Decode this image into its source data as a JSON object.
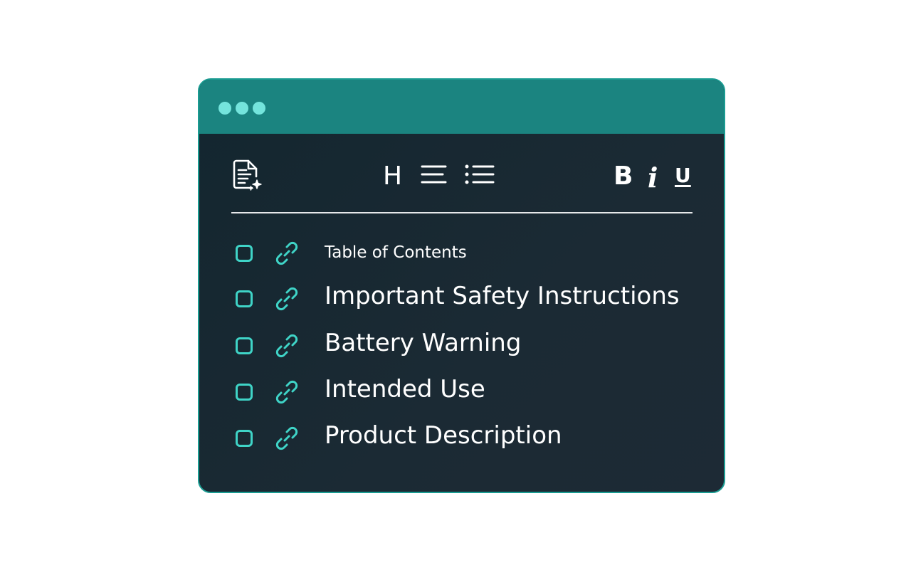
{
  "window": {
    "controls": [
      "dot",
      "dot",
      "dot"
    ]
  },
  "toolbar": {
    "doc_icon": "document-sparkle-icon",
    "heading_label": "H",
    "align_icon": "align-left-icon",
    "list_icon": "bulleted-list-icon",
    "bold_label": "B",
    "italic_label": "i",
    "underline_label": "U"
  },
  "toc": {
    "items": [
      {
        "label": "Table of Contents",
        "checked": false,
        "link_icon": "link-icon"
      },
      {
        "label": "Important Safety Instructions",
        "checked": false,
        "link_icon": "link-icon"
      },
      {
        "label": "Battery Warning",
        "checked": false,
        "link_icon": "link-icon"
      },
      {
        "label": "Intended Use",
        "checked": false,
        "link_icon": "link-icon"
      },
      {
        "label": "Product Description",
        "checked": false,
        "link_icon": "link-icon"
      }
    ]
  },
  "colors": {
    "titlebar": "#1b8480",
    "window_dots": "#74e4dc",
    "background": "#1b2a34",
    "accent": "#3fd4c7",
    "text": "#ffffff"
  }
}
